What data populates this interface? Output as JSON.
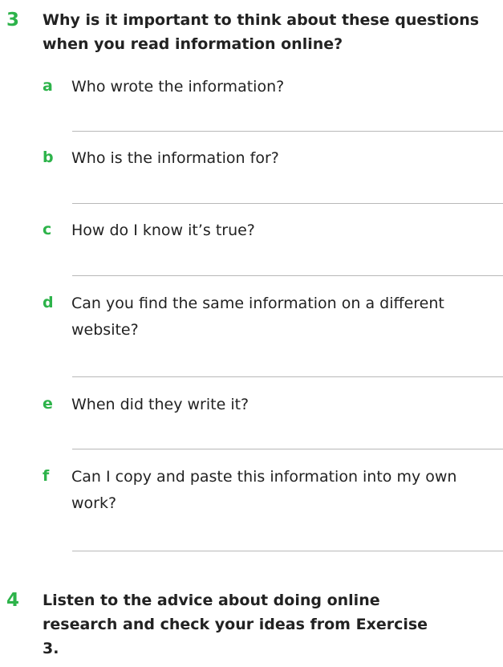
{
  "exercise3": {
    "number": "3",
    "prompt": "Why is it important to think about these questions when you read information online?",
    "questions": [
      {
        "letter": "a",
        "text": "Who wrote the information?"
      },
      {
        "letter": "b",
        "text": "Who is the information for?"
      },
      {
        "letter": "c",
        "text": "How do I know it’s true?"
      },
      {
        "letter": "d",
        "text": "Can you find the same information on a different website?"
      },
      {
        "letter": "e",
        "text": "When did they write it?"
      },
      {
        "letter": "f",
        "text": "Can I copy and paste this information into my own work?"
      }
    ]
  },
  "exercise4": {
    "number": "4",
    "prompt": "Listen to the advice about doing online research and check your ideas from Exercise 3."
  },
  "colors": {
    "accent": "#2db34a",
    "text": "#222222",
    "rule": "#b8b8b8"
  }
}
